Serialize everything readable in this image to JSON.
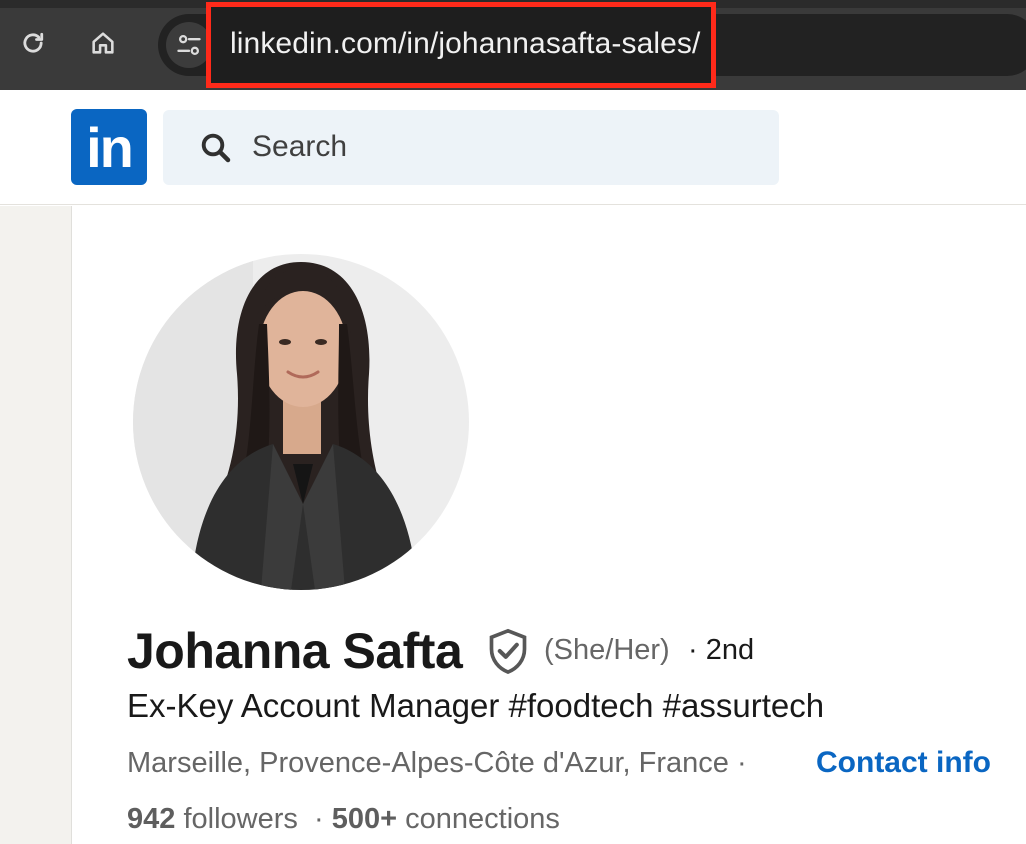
{
  "browser": {
    "url": "linkedin.com/in/johannasafta-sales/",
    "icons": [
      "reload-icon",
      "home-icon",
      "site-settings-icon"
    ]
  },
  "header": {
    "logo_text": "in",
    "search_placeholder": "Search"
  },
  "profile": {
    "name": "Johanna Safta",
    "pronouns": "(She/Her)",
    "degree": "· 2nd",
    "headline": "Ex-Key Account Manager #foodtech #assurtech",
    "location": "Marseille, Provence-Alpes-Côte d'Azur, France ·",
    "contact_label": "Contact info",
    "followers_count": "942",
    "followers_label": "followers",
    "separator": "·",
    "connections_count": "500+",
    "connections_label": "connections"
  },
  "colors": {
    "brand": "#0a66c2",
    "url_highlight": "#ff2a1a"
  }
}
